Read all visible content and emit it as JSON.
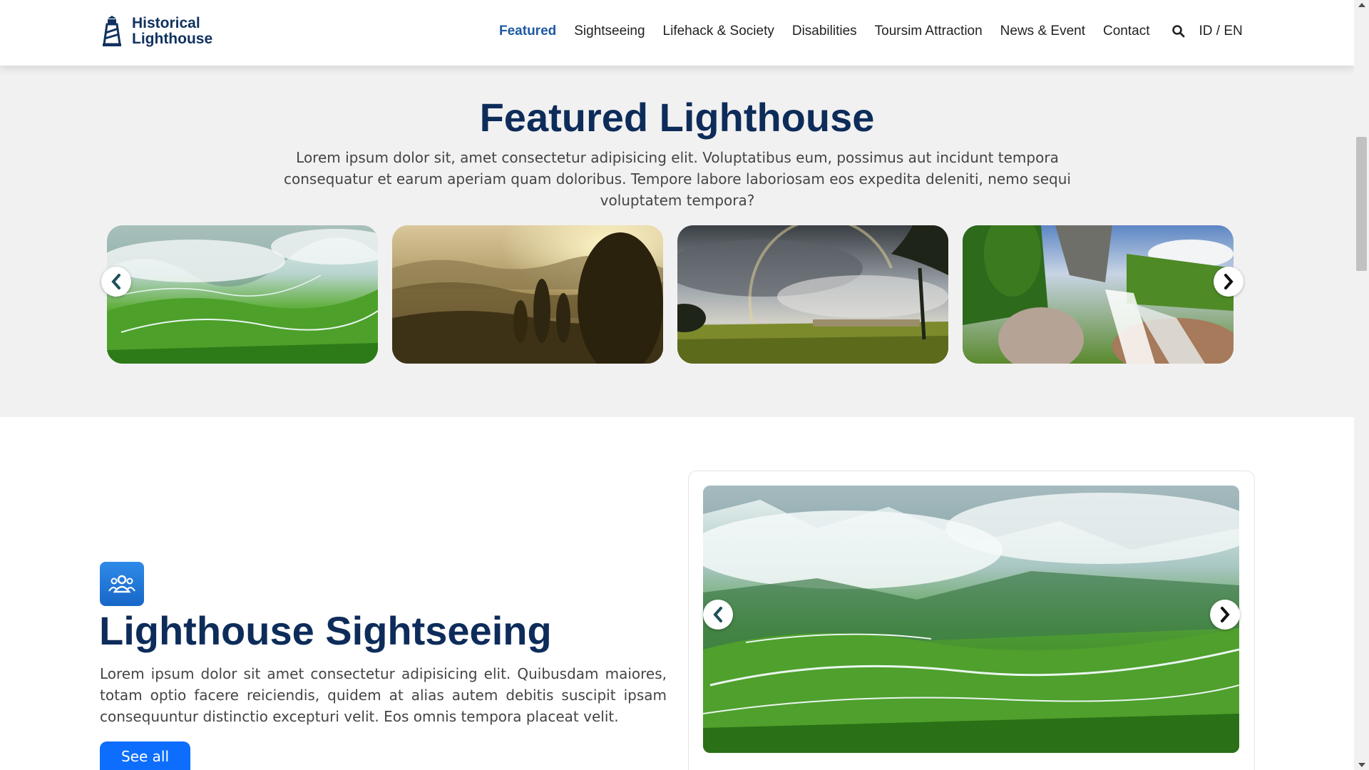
{
  "header": {
    "logo_line1": "Historical",
    "logo_line2": "Lighthouse",
    "nav": [
      {
        "label": "Featured",
        "active": true
      },
      {
        "label": "Sightseeing"
      },
      {
        "label": "Lifehack & Society"
      },
      {
        "label": "Disabilities"
      },
      {
        "label": "Toursim Attraction"
      },
      {
        "label": "News & Event"
      },
      {
        "label": "Contact"
      }
    ],
    "search_icon": "search-icon",
    "lang": "ID / EN"
  },
  "featured": {
    "title": "Featured Lighthouse",
    "description": "Lorem ipsum dolor sit, amet consectetur adipisicing elit. Voluptatibus eum, possimus aut incidunt tempora consequatur et earum aperiam quam doloribus. Tempore labore laboriosam eos expedita deleniti, nemo sequi voluptatem tempora?",
    "images": [
      "misty-green-valley",
      "golden-hills-sunset",
      "rainbow-stormy-field",
      "mountain-waterfall"
    ]
  },
  "sightseeing": {
    "icon": "people-icon",
    "title": "Lighthouse Sightseeing",
    "description": "Lorem ipsum dolor sit amet consectetur adipisicing elit. Quibusdam maiores, totam optio facere reiciendis, quidem at alias autem debitis suscipit ipsam consequuntur distinctio excepturi velit. Eos omnis tempora placeat velit.",
    "button": "See all",
    "image": "misty-green-valley"
  },
  "colors": {
    "primary_dark": "#0d2c5a",
    "accent_blue": "#0d6efd",
    "nav_active": "#1e5aa0",
    "section_bg": "#f2f1f1"
  }
}
